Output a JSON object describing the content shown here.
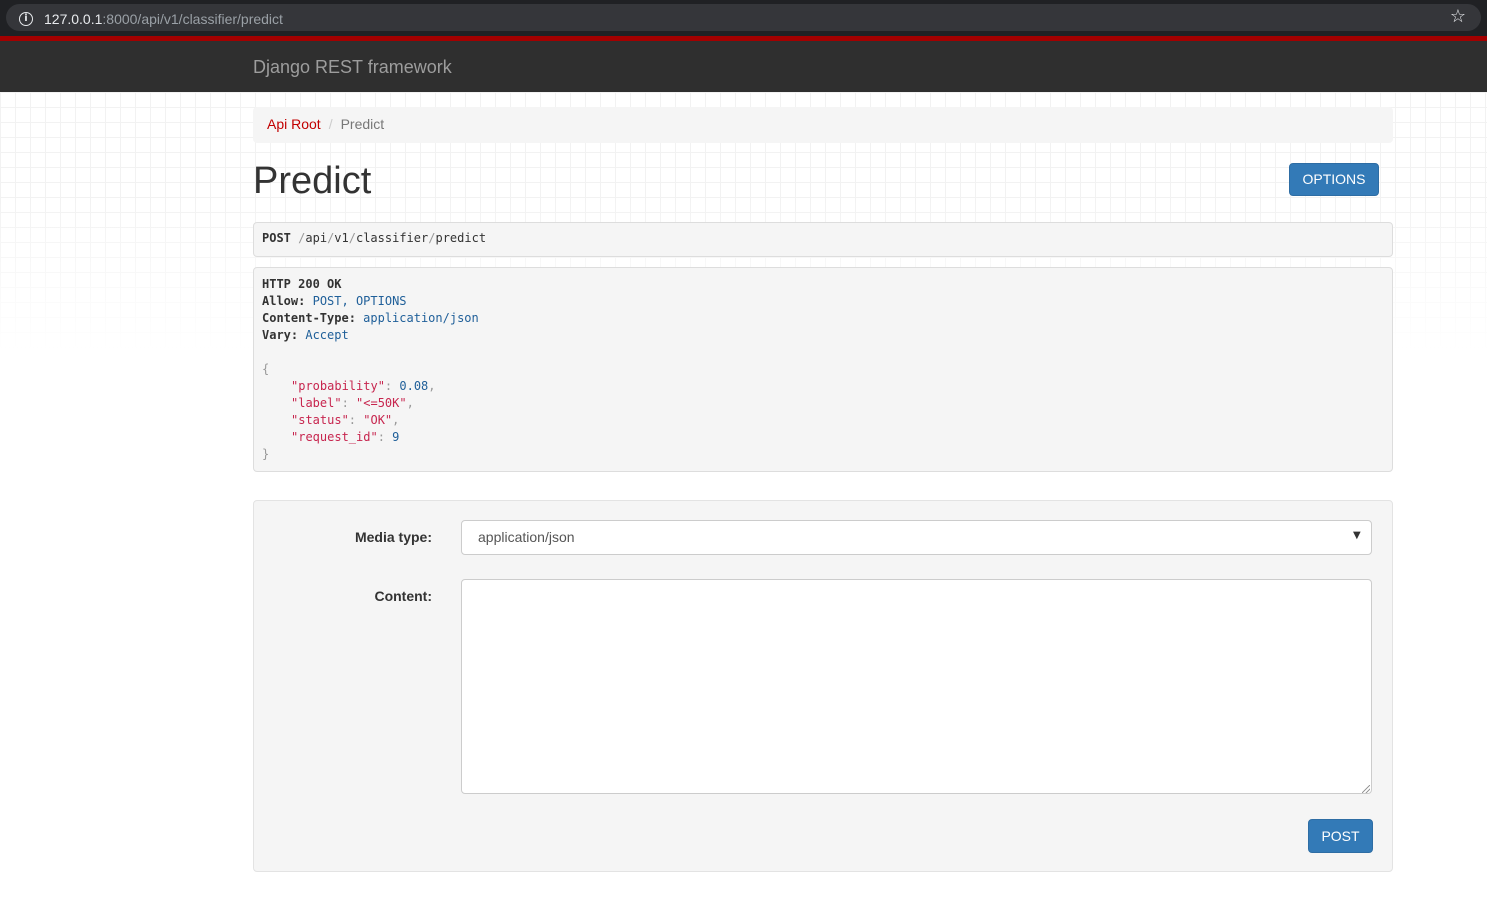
{
  "browser": {
    "url_host": "127.0.0.1",
    "url_rest": ":8000/api/v1/classifier/predict"
  },
  "navbar": {
    "brand": "Django REST framework"
  },
  "breadcrumb": {
    "items": [
      "Api Root",
      "Predict"
    ],
    "separator": "/"
  },
  "page": {
    "title": "Predict",
    "options_label": "OPTIONS"
  },
  "request": {
    "method": "POST",
    "path_parts": [
      "api",
      "v1",
      "classifier",
      "predict"
    ]
  },
  "response": {
    "status_line": "HTTP 200 OK",
    "headers": [
      {
        "key": "Allow:",
        "value": "POST, OPTIONS"
      },
      {
        "key": "Content-Type:",
        "value": "application/json"
      },
      {
        "key": "Vary:",
        "value": "Accept"
      }
    ],
    "body": [
      {
        "key": "\"probability\"",
        "value": "0.08",
        "kind": "num",
        "comma": ","
      },
      {
        "key": "\"label\"",
        "value": "\"<=50K\"",
        "kind": "str",
        "comma": ","
      },
      {
        "key": "\"status\"",
        "value": "\"OK\"",
        "kind": "str",
        "comma": ","
      },
      {
        "key": "\"request_id\"",
        "value": "9",
        "kind": "num",
        "comma": ""
      }
    ],
    "open_brace": "{",
    "close_brace": "}"
  },
  "form": {
    "media_type_label": "Media type:",
    "media_type_value": "application/json",
    "content_label": "Content:",
    "content_value": "",
    "submit_label": "POST"
  },
  "colors": {
    "navbar_accent": "#a30000",
    "button_primary": "#337ab7",
    "link": "#c20000"
  }
}
